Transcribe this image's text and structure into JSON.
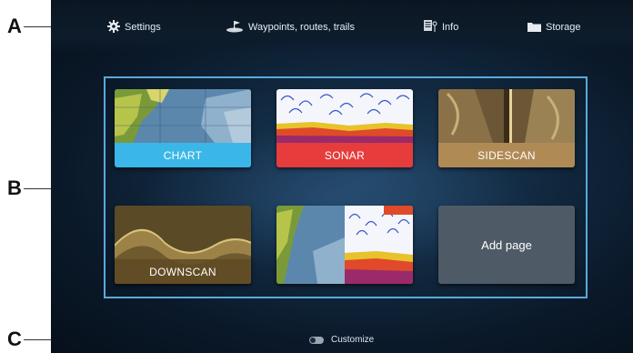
{
  "callouts": {
    "a": "A",
    "b": "B",
    "c": "C"
  },
  "topbar": {
    "settings_label": "Settings",
    "waypoints_label": "Waypoints, routes, trails",
    "info_label": "Info",
    "storage_label": "Storage"
  },
  "tiles": [
    {
      "label": "CHART",
      "color": "#3ab7e8"
    },
    {
      "label": "SONAR",
      "color": "#e63c3c"
    },
    {
      "label": "SIDESCAN",
      "color": "#b08a55"
    },
    {
      "label": "DOWNSCAN",
      "color": "#8a6d2c"
    },
    {
      "label": "",
      "color": ""
    },
    {
      "label": "Add page",
      "color": "#4e5b66"
    }
  ],
  "footer": {
    "customize_label": "Customize"
  },
  "colors": {
    "panel_border": "#5aa9d8",
    "background": "#0f2236"
  }
}
